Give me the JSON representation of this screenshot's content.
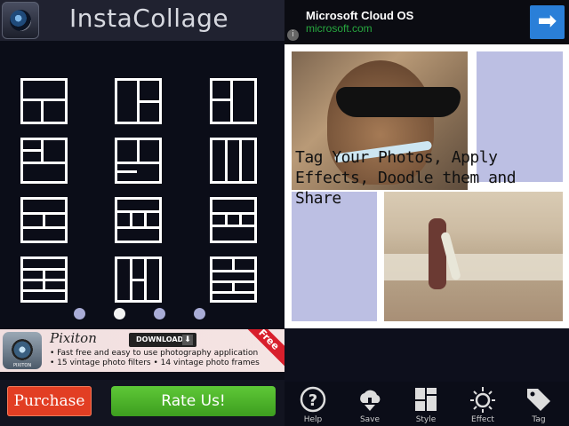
{
  "header": {
    "title": "InstaCollage"
  },
  "layout_grid": {
    "tile_count": 12
  },
  "pager": {
    "pages": 4,
    "active_index": 1
  },
  "promo": {
    "name": "Pixiton",
    "download_label": "DOWNLOAD",
    "line1": "• Fast free and easy to use photography application",
    "line2": "• 15 vintage photo filters   • 14 vintage photo frames",
    "ribbon": "Free",
    "icon_caption": "PIXITON"
  },
  "actions": {
    "purchase_label": "Purchase",
    "rate_label": "Rate Us!"
  },
  "top_ad": {
    "title": "Microsoft Cloud OS",
    "url": "microsoft.com",
    "info": "i"
  },
  "collage": {
    "overlay_text": "Tag Your Photos, Apply Effects, Doodle them and Share"
  },
  "toolbar": {
    "items": [
      {
        "label": "Help"
      },
      {
        "label": "Save"
      },
      {
        "label": "Style"
      },
      {
        "label": "Effect"
      },
      {
        "label": "Tag"
      }
    ]
  },
  "colors": {
    "purchase": "#e23e23",
    "rate": "#4db52a",
    "panel": "#bcbfe3",
    "ad_arrow": "#2a7fd8",
    "ad_url": "#27a83f"
  }
}
